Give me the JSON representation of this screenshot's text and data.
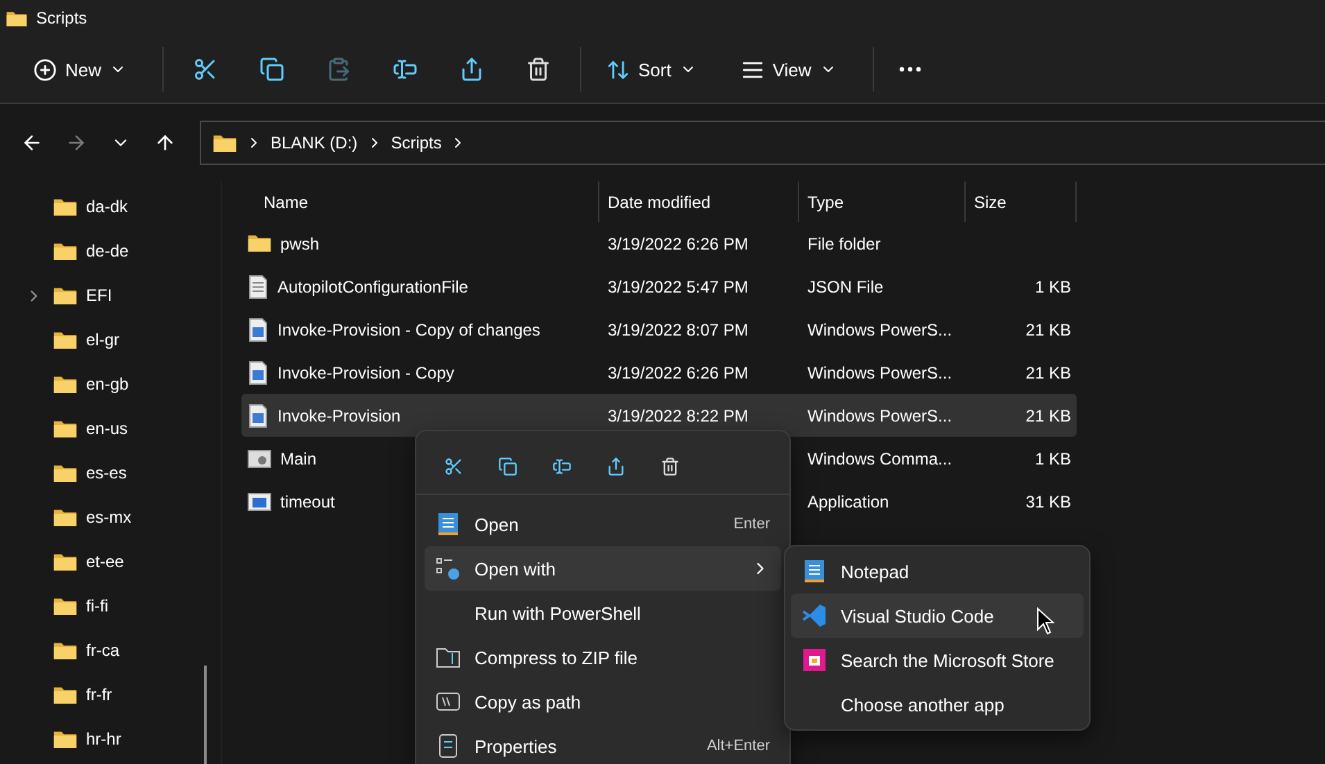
{
  "window": {
    "title": "Scripts"
  },
  "toolbar": {
    "items": [
      {
        "kind": "dropdown",
        "label": "New",
        "disabled": false
      },
      {
        "kind": "divider"
      },
      {
        "kind": "icon",
        "disabled": false
      },
      {
        "kind": "icon",
        "disabled": false
      },
      {
        "kind": "icon",
        "disabled": true
      },
      {
        "kind": "icon",
        "disabled": false
      },
      {
        "kind": "icon",
        "disabled": false
      },
      {
        "kind": "icon",
        "disabled": false
      },
      {
        "kind": "divider"
      },
      {
        "kind": "dropdown",
        "label": "Sort",
        "disabled": false
      },
      {
        "kind": "dropdown",
        "label": "View",
        "disabled": false
      },
      {
        "kind": "divider"
      },
      {
        "kind": "more",
        "disabled": false
      }
    ]
  },
  "nav": {
    "back_disabled": false,
    "forward_disabled": true,
    "breadcrumb": [
      "BLANK (D:)",
      "Scripts"
    ]
  },
  "sidebar": {
    "items": [
      {
        "label": "da-dk",
        "expandable": false
      },
      {
        "label": "de-de",
        "expandable": false
      },
      {
        "label": "EFI",
        "expandable": true
      },
      {
        "label": "el-gr",
        "expandable": false
      },
      {
        "label": "en-gb",
        "expandable": false
      },
      {
        "label": "en-us",
        "expandable": false
      },
      {
        "label": "es-es",
        "expandable": false
      },
      {
        "label": "es-mx",
        "expandable": false
      },
      {
        "label": "et-ee",
        "expandable": false
      },
      {
        "label": "fi-fi",
        "expandable": false
      },
      {
        "label": "fr-ca",
        "expandable": false
      },
      {
        "label": "fr-fr",
        "expandable": false
      },
      {
        "label": "hr-hr",
        "expandable": false
      }
    ]
  },
  "table": {
    "columns": [
      "Name",
      "Date modified",
      "Type",
      "Size"
    ],
    "rows": [
      {
        "kind": "folder",
        "name": "pwsh",
        "date": "3/19/2022 6:26 PM",
        "type": "File folder",
        "selected": false
      },
      {
        "kind": "text",
        "name": "AutopilotConfigurationFile",
        "date": "3/19/2022 5:47 PM",
        "type": "JSON File",
        "size": "1 KB",
        "selected": false
      },
      {
        "kind": "script",
        "name": "Invoke-Provision - Copy of changes",
        "date": "3/19/2022 8:07 PM",
        "type": "Windows PowerS...",
        "size": "21 KB",
        "selected": false
      },
      {
        "kind": "script",
        "name": "Invoke-Provision - Copy",
        "date": "3/19/2022 6:26 PM",
        "type": "Windows PowerS...",
        "size": "21 KB",
        "selected": false
      },
      {
        "kind": "script",
        "name": "Invoke-Provision",
        "date": "3/19/2022 8:22 PM",
        "type": "Windows PowerS...",
        "size": "21 KB",
        "selected": true
      },
      {
        "kind": "batch",
        "name": "Main",
        "type": "Windows Comma...",
        "size": "1 KB",
        "selected": false
      },
      {
        "kind": "app",
        "name": "timeout",
        "type": "Application",
        "size": "31 KB",
        "selected": false
      }
    ]
  },
  "context_menu": {
    "items": [
      {
        "label": "Open",
        "shortcut": "Enter",
        "submenu": false,
        "selected": false
      },
      {
        "label": "Open with",
        "submenu": true,
        "selected": true
      },
      {
        "label": "Run with PowerShell",
        "submenu": false,
        "selected": false
      },
      {
        "label": "Compress to ZIP file",
        "submenu": false,
        "selected": false
      },
      {
        "label": "Copy as path",
        "submenu": false,
        "selected": false
      },
      {
        "label": "Properties",
        "shortcut": "Alt+Enter",
        "submenu": false,
        "selected": false
      }
    ]
  },
  "submenu": {
    "items": [
      {
        "label": "Notepad",
        "selected": false
      },
      {
        "label": "Visual Studio Code",
        "selected": true
      },
      {
        "label": "Search the Microsoft Store",
        "selected": false
      },
      {
        "label": "Choose another app",
        "selected": false
      }
    ]
  }
}
